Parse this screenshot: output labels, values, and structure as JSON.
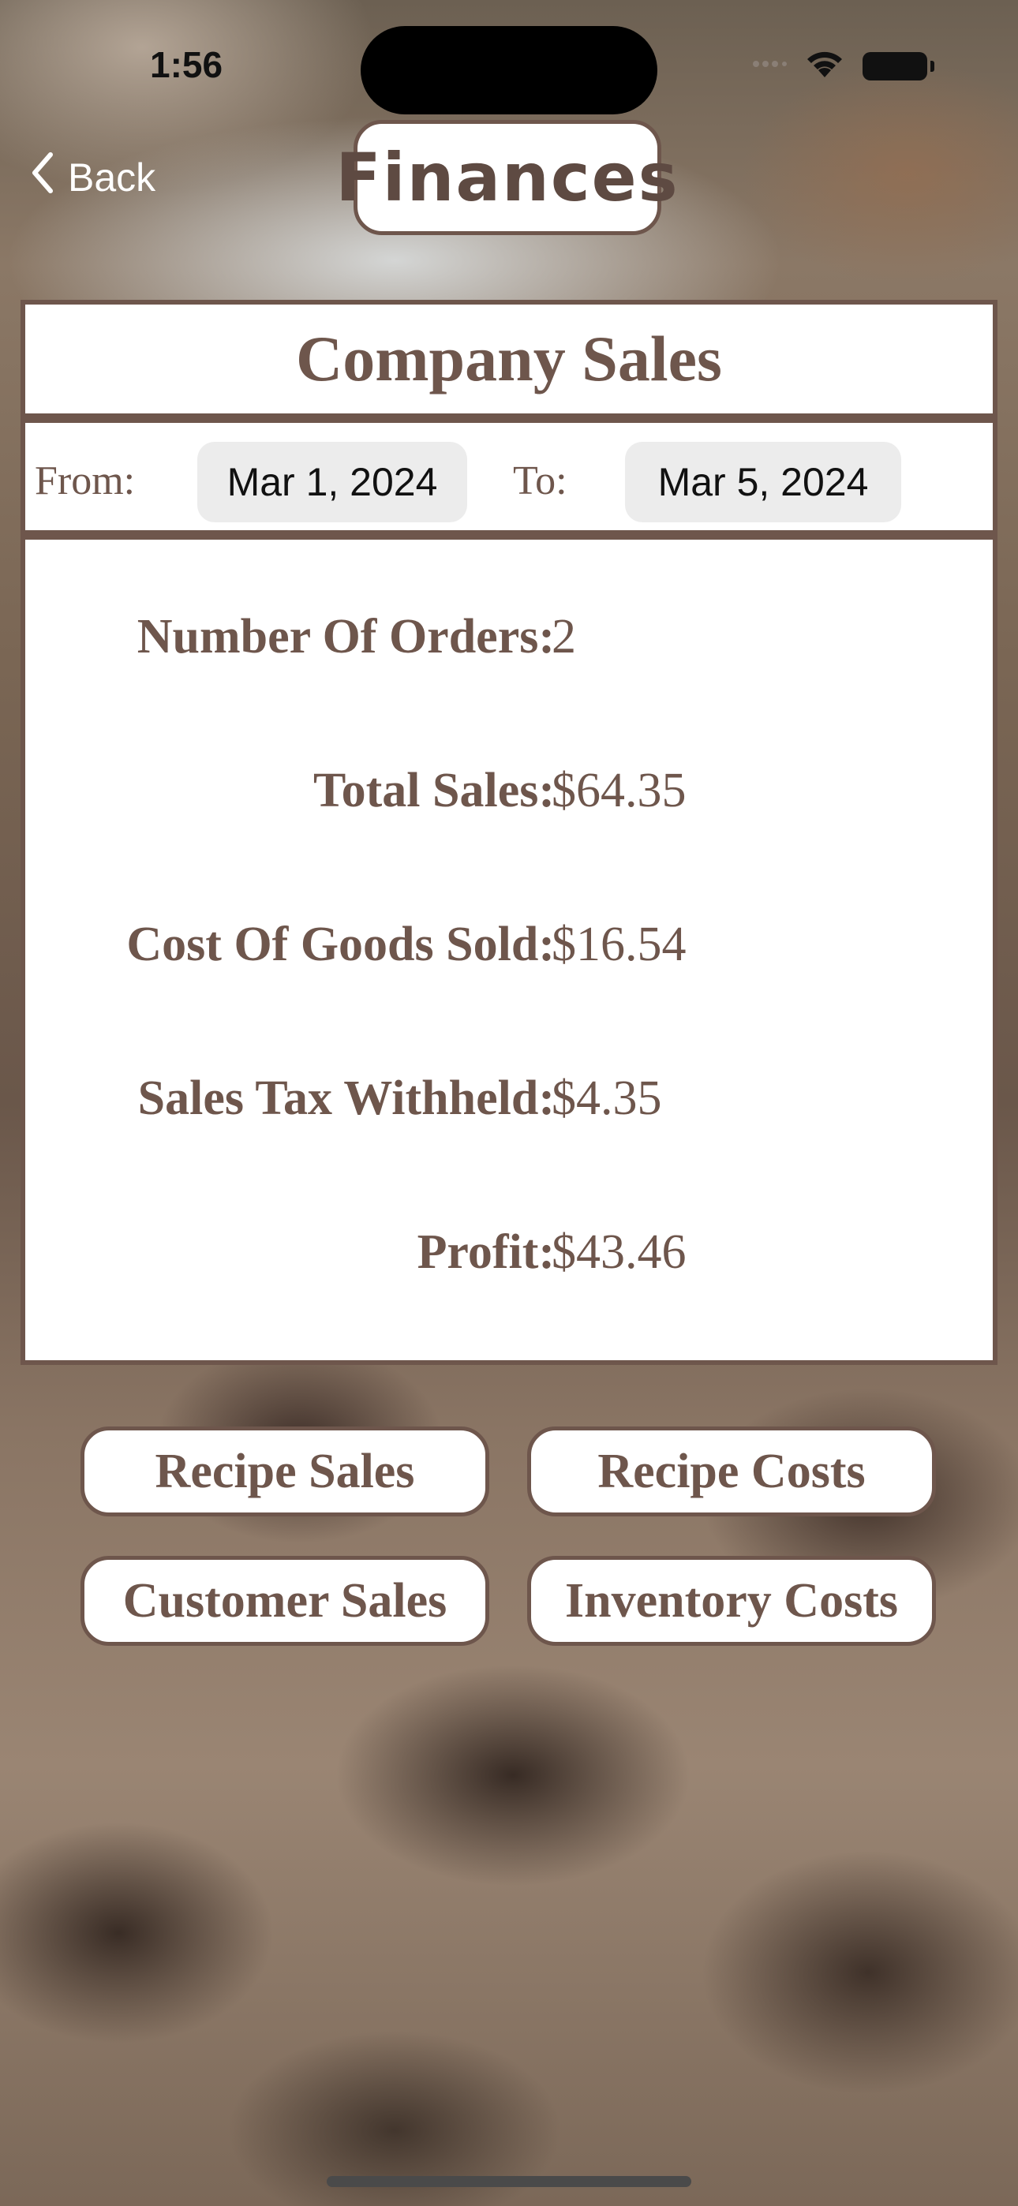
{
  "status_bar": {
    "time": "1:56"
  },
  "nav": {
    "back_label": "Back",
    "title": "Finances"
  },
  "company_sales": {
    "title": "Company Sales",
    "from_label": "From:",
    "from_date": "Mar 1, 2024",
    "to_label": "To:",
    "to_date": "Mar 5, 2024"
  },
  "stats": [
    {
      "label": "Number Of Orders:",
      "value": "2"
    },
    {
      "label": "Total Sales:",
      "value": "$64.35"
    },
    {
      "label": "Cost Of Goods Sold:",
      "value": "$16.54"
    },
    {
      "label": "Sales Tax Withheld:",
      "value": "$4.35"
    },
    {
      "label": "Profit:",
      "value": "$43.46"
    }
  ],
  "buttons": {
    "recipe_sales": "Recipe Sales",
    "recipe_costs": "Recipe Costs",
    "customer_sales": "Customer Sales",
    "inventory_costs": "Inventory Costs"
  },
  "colors": {
    "accent_brown": "#6e564c",
    "panel_background": "#ffffff",
    "date_pill_background": "#ececec"
  },
  "icons": {
    "back": "chevron-left-icon",
    "wifi": "wifi-icon",
    "battery": "battery-icon"
  }
}
